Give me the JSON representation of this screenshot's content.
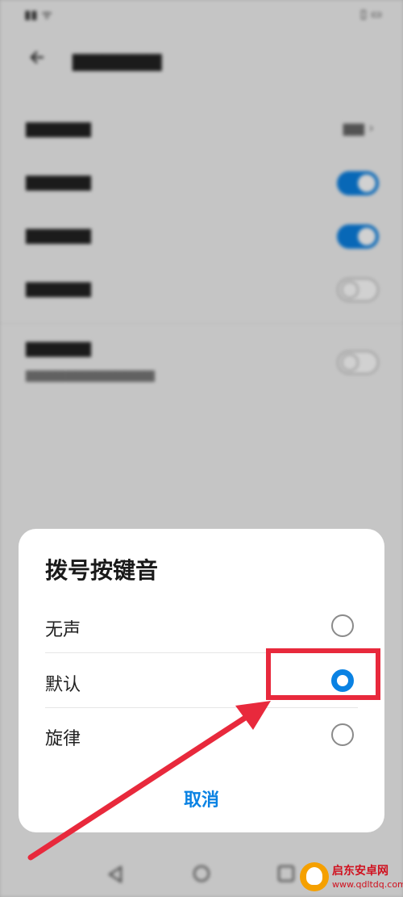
{
  "dialog": {
    "title": "拨号按键音",
    "options": [
      {
        "label": "无声",
        "selected": false
      },
      {
        "label": "默认",
        "selected": true
      },
      {
        "label": "旋律",
        "selected": false
      }
    ],
    "cancel_label": "取消"
  },
  "watermark": {
    "name": "启东安卓网",
    "url": "www.qdltdq.com"
  },
  "colors": {
    "accent": "#0a82e3",
    "highlight": "#e8293c"
  }
}
